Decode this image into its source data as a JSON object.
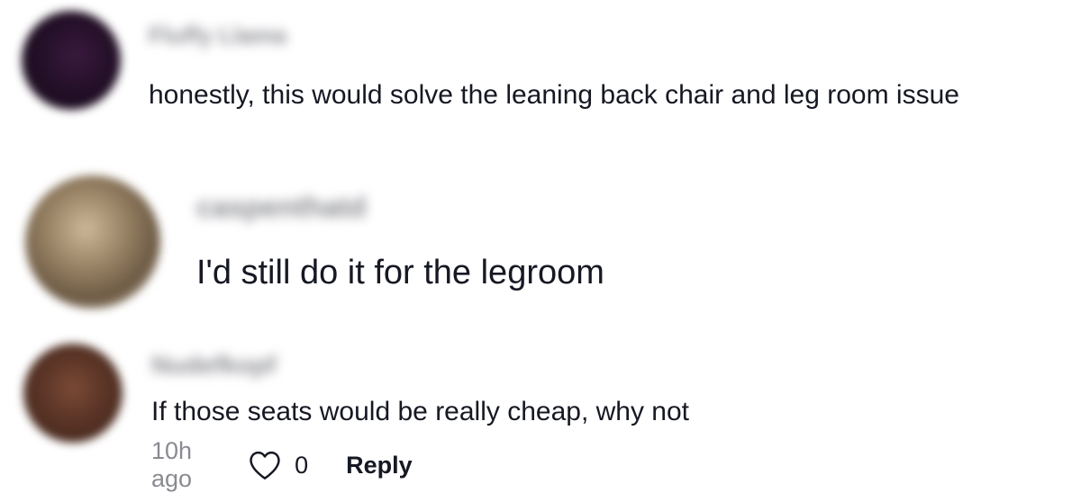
{
  "comments": [
    {
      "username": "Fluffy Llama",
      "text": "honestly, this would solve the leaning back chair and leg room issue"
    },
    {
      "username": "caspenthatd",
      "text": "I'd still do it for the legroom"
    },
    {
      "username": "Nudefkopf",
      "text": "If those seats would be really cheap, why not",
      "time": "10h ago",
      "like_count": "0",
      "reply_label": "Reply"
    }
  ],
  "colors": {
    "text_primary": "#161823",
    "text_secondary": "#8a8b91"
  },
  "icons": {
    "like": "heart-outline-icon"
  }
}
